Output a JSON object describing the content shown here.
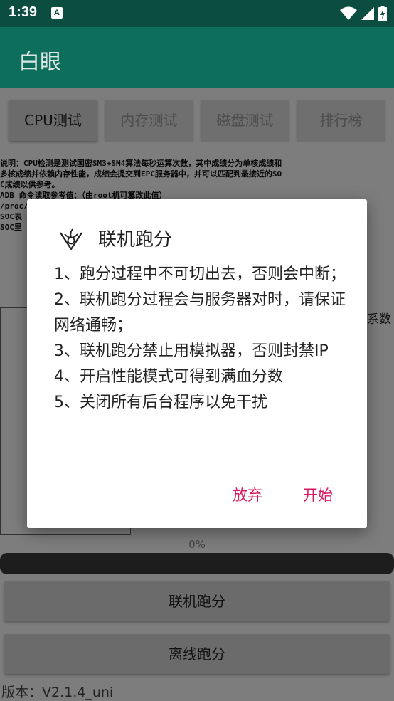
{
  "status_bar": {
    "time": "1:39",
    "notification_letter": "A"
  },
  "app_bar": {
    "title": "白眼"
  },
  "tabs": [
    {
      "label": "CPU测试",
      "active": true
    },
    {
      "label": "内存测试",
      "active": false
    },
    {
      "label": "磁盘测试",
      "active": false
    },
    {
      "label": "排行榜",
      "active": false
    }
  ],
  "description": {
    "lines": [
      "说明：CPU检测是测试国密SM3+SM4算法每秒运算次数，其中成绩分为单核成绩和",
      "多核成绩并依赖内存性能，成绩会提交到EPC服务器中，并可以匹配到最接近的SO",
      "C成绩以供参考。",
      "ADB 命令读取参考值：（由root机可篡改此值）",
      "/proc/",
      "SOC表",
      "SOC里"
    ]
  },
  "coef_label": "系数",
  "progress": {
    "text": "0%",
    "value": 0
  },
  "buttons": {
    "online_run": "联机跑分",
    "offline_run": "离线跑分"
  },
  "version": "版本：V2.1.4_uni",
  "dialog": {
    "title": "联机跑分",
    "items": [
      "1、跑分过程中不可切出去，否则会中断；",
      "2、联机跑分过程会与服务器对时，请保证网络通畅；",
      "3、联机跑分禁止用模拟器，否则封禁IP",
      "4、开启性能模式可得到满血分数",
      "5、关闭所有后台程序以免干扰"
    ],
    "cancel_label": "放弃",
    "confirm_label": "开始"
  },
  "colors": {
    "status_bar": "#0b4d40",
    "app_bar": "#0e6e5c",
    "accent": "#d81b60"
  }
}
